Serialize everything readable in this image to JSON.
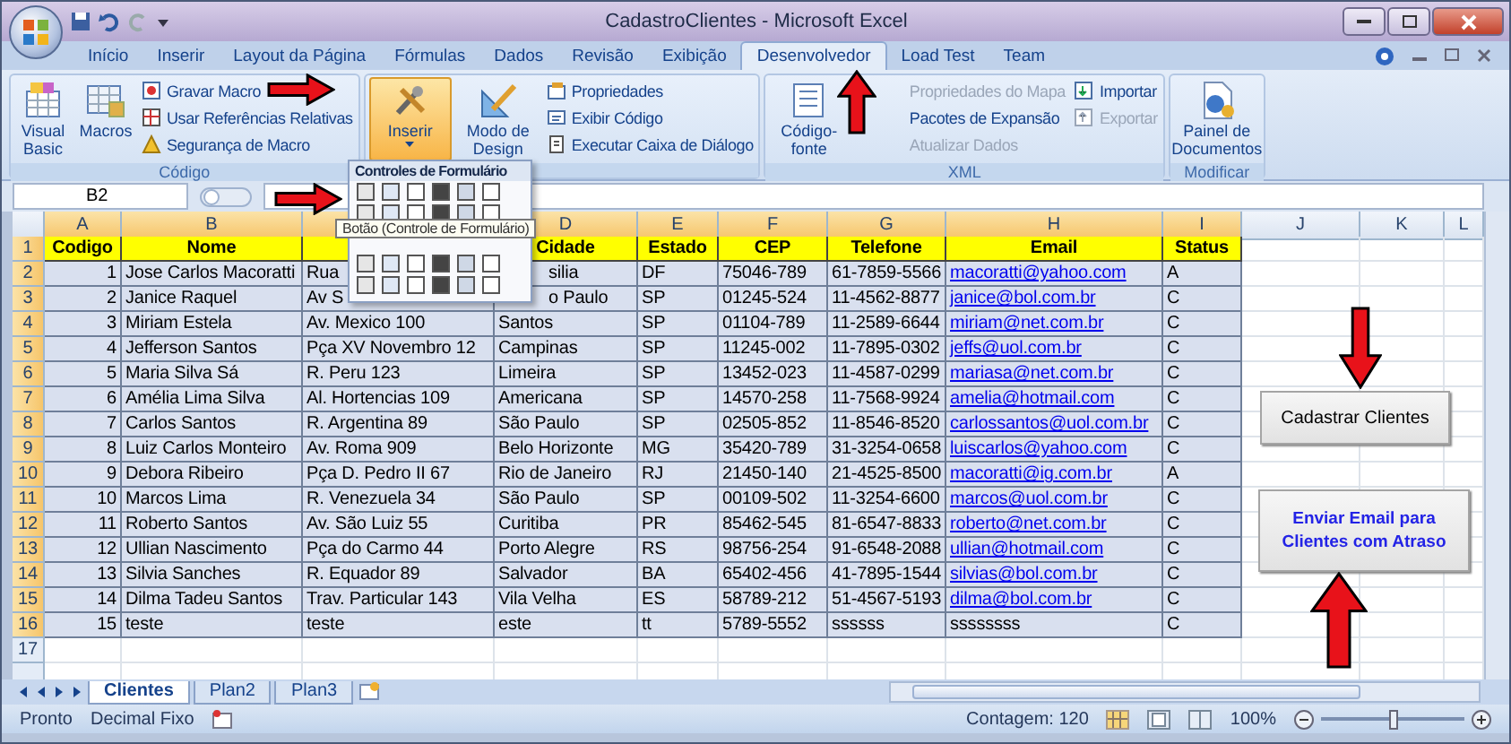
{
  "window": {
    "title": "CadastroClientes - Microsoft Excel"
  },
  "ribbon_tabs": [
    {
      "label": "Início",
      "selected": false
    },
    {
      "label": "Inserir",
      "selected": false
    },
    {
      "label": "Layout da Página",
      "selected": false
    },
    {
      "label": "Fórmulas",
      "selected": false
    },
    {
      "label": "Dados",
      "selected": false
    },
    {
      "label": "Revisão",
      "selected": false
    },
    {
      "label": "Exibição",
      "selected": false
    },
    {
      "label": "Desenvolvedor",
      "selected": true
    },
    {
      "label": "Load Test",
      "selected": false
    },
    {
      "label": "Team",
      "selected": false
    }
  ],
  "ribbon_groups": [
    {
      "label": "Código",
      "items": [
        {
          "label": "Visual Basic",
          "kind": "large",
          "disabled": false,
          "pressed": false
        },
        {
          "label": "Macros",
          "kind": "large",
          "disabled": false,
          "pressed": false
        },
        {
          "label": "Gravar Macro",
          "kind": "small",
          "disabled": false,
          "pressed": false
        },
        {
          "label": "Usar Referências Relativas",
          "kind": "small",
          "disabled": false,
          "pressed": false
        },
        {
          "label": "Segurança de Macro",
          "kind": "small",
          "disabled": false,
          "pressed": false
        }
      ]
    },
    {
      "items": [
        {
          "label": "Inserir",
          "kind": "large",
          "disabled": false,
          "pressed": true
        },
        {
          "label": "Modo de Design",
          "kind": "large",
          "disabled": false,
          "pressed": false
        },
        {
          "label": "Propriedades",
          "kind": "small",
          "disabled": false,
          "pressed": false
        },
        {
          "label": "Exibir Código",
          "kind": "small",
          "disabled": false,
          "pressed": false
        },
        {
          "label": "Executar Caixa de Diálogo",
          "kind": "small",
          "disabled": false,
          "pressed": false
        }
      ]
    },
    {
      "label": "XML",
      "items": [
        {
          "label": "Código-fonte",
          "kind": "large",
          "disabled": false,
          "pressed": false
        },
        {
          "label": "Propriedades do Mapa",
          "kind": "small",
          "disabled": true,
          "pressed": false
        },
        {
          "label": "Pacotes de Expansão",
          "kind": "small",
          "disabled": false,
          "pressed": false
        },
        {
          "label": "Atualizar Dados",
          "kind": "small",
          "disabled": true,
          "pressed": false
        },
        {
          "label": "Importar",
          "kind": "small",
          "disabled": false,
          "pressed": false
        },
        {
          "label": "Exportar",
          "kind": "small",
          "disabled": true,
          "pressed": false
        }
      ]
    },
    {
      "label": "Modificar",
      "items": [
        {
          "label": "Painel de Documentos",
          "kind": "large",
          "disabled": false,
          "pressed": false
        }
      ]
    }
  ],
  "form_controls_menu": {
    "title": "Controles de Formulário",
    "tooltip": "Botão (Controle de Formulário)"
  },
  "name_box": "B2",
  "columns": [
    {
      "letter": "A",
      "header": "Codigo"
    },
    {
      "letter": "B",
      "header": "Nome"
    },
    {},
    {
      "letter": "D",
      "header": "Cidade"
    },
    {
      "letter": "E",
      "header": "Estado"
    },
    {
      "letter": "F",
      "header": "CEP"
    },
    {
      "letter": "G",
      "header": "Telefone"
    },
    {
      "letter": "H",
      "header": "Email"
    },
    {
      "letter": "I",
      "header": "Status"
    },
    {
      "letter": "J"
    },
    {
      "letter": "K"
    },
    {
      "letter": "L"
    }
  ],
  "header_row_number": "1",
  "rows": [
    {
      "number": "2",
      "cells": [
        "1",
        "Jose Carlos Macoratti",
        "Rua",
        {
          "text": "silia",
          "clipped": true
        },
        "DF",
        "75046-789",
        "61-7859-5566",
        "macoratti@yahoo.com",
        "A"
      ]
    },
    {
      "number": "3",
      "cells": [
        "2",
        "Janice Raquel",
        "Av S",
        {
          "text": "o Paulo",
          "clipped": true
        },
        "SP",
        "01245-524",
        "11-4562-8877",
        "janice@bol.com.br",
        "C"
      ]
    },
    {
      "number": "4",
      "cells": [
        "3",
        "Miriam Estela",
        "Av. Mexico 100",
        "Santos",
        "SP",
        "01104-789",
        "11-2589-6644",
        "miriam@net.com.br",
        "C"
      ]
    },
    {
      "number": "5",
      "cells": [
        "4",
        "Jefferson Santos",
        "Pça XV Novembro 12",
        "Campinas",
        "SP",
        "11245-002",
        "11-7895-0302",
        "jeffs@uol.com.br",
        "C"
      ]
    },
    {
      "number": "6",
      "cells": [
        "5",
        "Maria Silva Sá",
        "R. Peru 123",
        "Limeira",
        "SP",
        "13452-023",
        "11-4587-0299",
        "mariasa@net.com.br",
        "C"
      ]
    },
    {
      "number": "7",
      "cells": [
        "6",
        "Amélia Lima Silva",
        "Al. Hortencias 109",
        "Americana",
        "SP",
        "14570-258",
        "11-7568-9924",
        "amelia@hotmail.com",
        "C"
      ]
    },
    {
      "number": "8",
      "cells": [
        "7",
        "Carlos Santos",
        "R. Argentina 89",
        "São Paulo",
        "SP",
        "02505-852",
        "11-8546-8520",
        "carlossantos@uol.com.br",
        "C"
      ]
    },
    {
      "number": "9",
      "cells": [
        "8",
        "Luiz Carlos Monteiro",
        "Av. Roma 909",
        "Belo Horizonte",
        "MG",
        "35420-789",
        "31-3254-0658",
        "luiscarlos@yahoo.com",
        "C"
      ]
    },
    {
      "number": "10",
      "cells": [
        "9",
        "Debora Ribeiro",
        "Pça D. Pedro II 67",
        "Rio de Janeiro",
        "RJ",
        "21450-140",
        "21-4525-8500",
        "macoratti@ig.com.br",
        "A"
      ]
    },
    {
      "number": "11",
      "cells": [
        "10",
        "Marcos Lima",
        "R. Venezuela 34",
        "São Paulo",
        "SP",
        "00109-502",
        "11-3254-6600",
        "marcos@uol.com.br",
        "C"
      ]
    },
    {
      "number": "12",
      "cells": [
        "11",
        "Roberto Santos",
        "Av. São Luiz 55",
        "Curitiba",
        "PR",
        "85462-545",
        "81-6547-8833",
        "roberto@net.com.br",
        "C"
      ]
    },
    {
      "number": "13",
      "cells": [
        "12",
        "Ullian Nascimento",
        "Pça do Carmo 44",
        "Porto Alegre",
        "RS",
        "98756-254",
        "91-6548-2088",
        "ullian@hotmail.com",
        "C"
      ]
    },
    {
      "number": "14",
      "cells": [
        "13",
        "Silvia Sanches",
        "R. Equador 89",
        "Salvador",
        "BA",
        "65402-456",
        "41-7895-1544",
        "silvias@bol.com.br",
        "C"
      ]
    },
    {
      "number": "15",
      "cells": [
        "14",
        "Dilma Tadeu Santos",
        "Trav. Particular 143",
        "Vila Velha",
        "ES",
        "58789-212",
        "51-4567-5193",
        "dilma@bol.com.br",
        "C"
      ]
    },
    {
      "number": "16",
      "cells": [
        "15",
        "teste",
        "teste",
        "este",
        "tt",
        "5789-5552",
        "ssssss",
        "ssssssss",
        "C"
      ]
    }
  ],
  "empty_rows": [
    "17"
  ],
  "sheet_buttons": [
    {
      "label": "Cadastrar Clientes",
      "kind": "plain"
    },
    {
      "label": "Enviar Email para Clientes com Atraso",
      "kind": "bold"
    }
  ],
  "annotations": [
    {
      "kind": "arrow_right"
    },
    {
      "kind": "arrow_right"
    },
    {
      "kind": "arrow_up"
    },
    {
      "kind": "arrow_down"
    },
    {
      "kind": "arrow_up"
    }
  ],
  "sheet_tabs": [
    {
      "label": "Clientes",
      "selected": true
    },
    {
      "label": "Plan2",
      "selected": false
    },
    {
      "label": "Plan3",
      "selected": false
    }
  ],
  "status_bar": {
    "items": [
      "Pronto",
      "Decimal Fixo"
    ],
    "count": "Contagem: 120",
    "zoom": "100%",
    "zoom_slider": {
      "level": 0.5
    }
  }
}
